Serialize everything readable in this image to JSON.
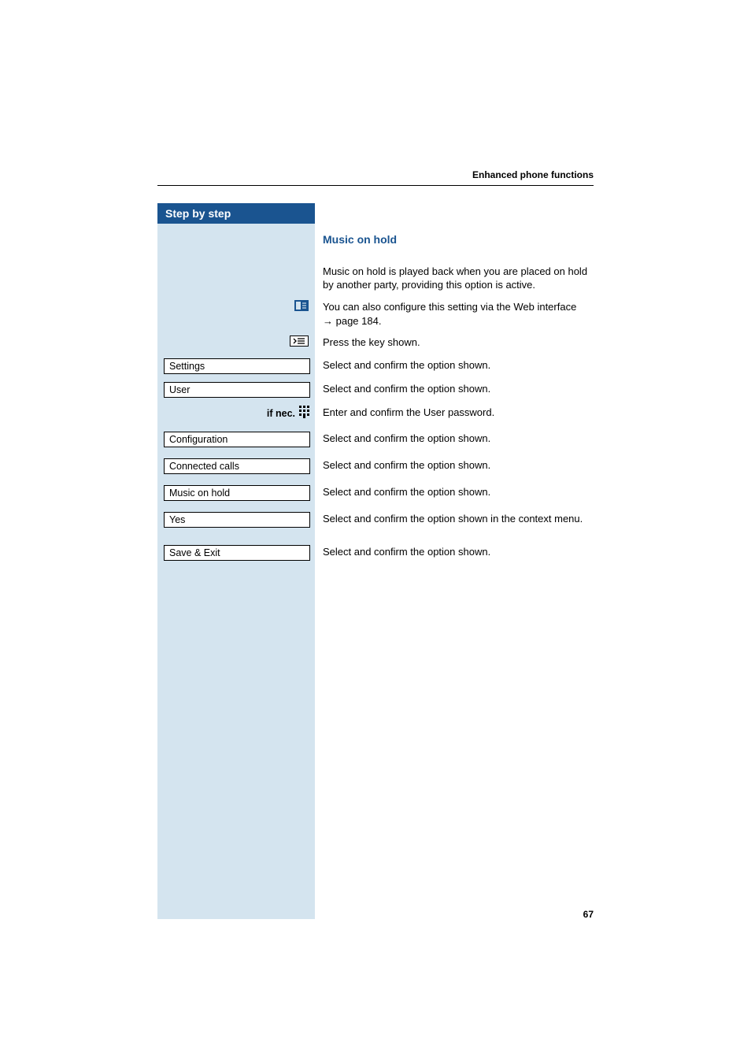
{
  "header": {
    "title": "Enhanced phone functions"
  },
  "stepByStep": {
    "title": "Step by step"
  },
  "section": {
    "title": "Music on hold",
    "intro": "Music on hold is played back when you are placed on hold by another party, providing this option is active.",
    "webInterface_prefix": "You can also configure this setting via the Web interface ",
    "webInterface_arrow": "→",
    "webInterface_suffix": " page 184.",
    "pressKey": "Press the key shown.",
    "ifNec": "if nec."
  },
  "steps": {
    "settings": {
      "label": "Settings",
      "desc": "Select and confirm the option shown."
    },
    "user": {
      "label": "User",
      "desc": "Select and confirm the option shown."
    },
    "password": {
      "desc": "Enter and confirm the User password."
    },
    "configuration": {
      "label": "Configuration",
      "desc": "Select and confirm the option shown."
    },
    "connectedCalls": {
      "label": "Connected calls",
      "desc": "Select and confirm the option shown."
    },
    "musicOnHold": {
      "label": "Music on hold",
      "desc": "Select and confirm the option shown."
    },
    "yes": {
      "label": "Yes",
      "desc": "Select and confirm the option shown in the context menu."
    },
    "saveExit": {
      "label": "Save & Exit",
      "desc": "Select and confirm the option shown."
    }
  },
  "pageNumber": "67"
}
